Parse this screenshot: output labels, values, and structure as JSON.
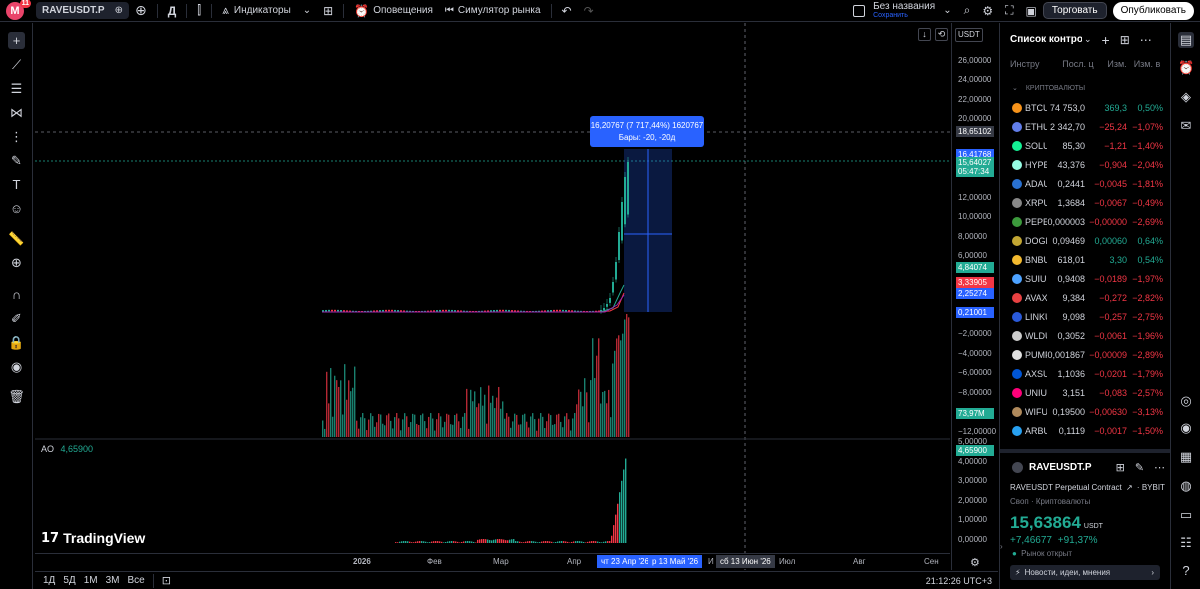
{
  "topbar": {
    "notif_count": "11",
    "symbol": "RAVEUSDT.P",
    "interval": "Д",
    "indicators": "Индикаторы",
    "alerts": "Оповещения",
    "replay": "Симулятор рынка",
    "layout_name": "Без названия",
    "layout_status": "Сохранить",
    "trade": "Торговать",
    "publish": "Опубликовать"
  },
  "chart_header": {
    "currency": "USDT"
  },
  "price_axis": {
    "labels": [
      "26,00000",
      "24,00000",
      "22,00000",
      "20,00000",
      "12,00000",
      "10,00000",
      "8,00000",
      "6,00000",
      "−2,00000",
      "−4,00000",
      "−6,00000",
      "−8,00000",
      "−12,00000"
    ],
    "crosshair": "18,65102",
    "tag_top": "16,41768",
    "tag_price": "15,64027",
    "tag_timer": "05:47:34",
    "tag_ema1": "4,84074",
    "tag_ema2": "3,33905",
    "tag_ema3": "2,25274",
    "tag_low": "0,21001",
    "tag_volume": "73,97M",
    "osc_labels": [
      "5,00000",
      "4,00000",
      "3,00000",
      "2,00000",
      "1,00000",
      "0,00000"
    ],
    "tag_osc": "4,65900"
  },
  "measure": {
    "line1": "16,20767 (7 717,44%) 1620767",
    "line2": "Бары: -20, -20д"
  },
  "oscillator": {
    "name": "AO",
    "value": "4,65900"
  },
  "time_axis": {
    "labels": [
      "2026",
      "Фев",
      "Мар",
      "Апр",
      "Июл",
      "Авг",
      "Сен"
    ],
    "range_start": "чт 23 Апр '26",
    "range_end": "р 13 Май '26",
    "partial": "И",
    "crosshair": "сб 13 Июн '26"
  },
  "bottombar": {
    "ranges": [
      "1Д",
      "5Д",
      "1М",
      "3М",
      "Все"
    ],
    "clock": "21:12:26 UTC+3"
  },
  "watermark": "TradingView",
  "watchlist": {
    "title": "Список контрол",
    "columns": [
      "Инстру",
      "Посл. ц",
      "Изм.",
      "Изм. в"
    ],
    "section": "КРИПТОВАЛЮТЫ",
    "items": [
      {
        "sym": "BTCUS",
        "last": "74 753,0",
        "chg": "369,3",
        "pct": "0,50%",
        "dir": "pos",
        "color": "#f7931a"
      },
      {
        "sym": "ETHUS",
        "last": "2 342,70",
        "chg": "−25,24",
        "pct": "−1,07%",
        "dir": "neg",
        "color": "#627eea"
      },
      {
        "sym": "SOLUS",
        "last": "85,30",
        "chg": "−1,21",
        "pct": "−1,40%",
        "dir": "neg",
        "color": "#14f195"
      },
      {
        "sym": "HYPEI",
        "last": "43,376",
        "chg": "−0,904",
        "pct": "−2,04%",
        "dir": "neg",
        "color": "#97fce4"
      },
      {
        "sym": "ADAUS",
        "last": "0,2441",
        "chg": "−0,0045",
        "pct": "−1,81%",
        "dir": "neg",
        "color": "#2a71d0"
      },
      {
        "sym": "XRPUS",
        "last": "1,3684",
        "chg": "−0,0067",
        "pct": "−0,49%",
        "dir": "neg",
        "color": "#888888"
      },
      {
        "sym": "PEPEU",
        "last": "0,000003",
        "chg": "−0,00000",
        "pct": "−2,69%",
        "dir": "neg",
        "color": "#3c9a3c"
      },
      {
        "sym": "DOGEI",
        "last": "0,09469",
        "chg": "0,00060",
        "pct": "0,64%",
        "dir": "pos",
        "color": "#c2a633"
      },
      {
        "sym": "BNBUS",
        "last": "618,01",
        "chg": "3,30",
        "pct": "0,54%",
        "dir": "pos",
        "color": "#f3ba2f"
      },
      {
        "sym": "SUIUS",
        "last": "0,9408",
        "chg": "−0,0189",
        "pct": "−1,97%",
        "dir": "neg",
        "color": "#4da2ff"
      },
      {
        "sym": "AVAXU",
        "last": "9,384",
        "chg": "−0,272",
        "pct": "−2,82%",
        "dir": "neg",
        "color": "#e84142"
      },
      {
        "sym": "LINKU",
        "last": "9,098",
        "chg": "−0,257",
        "pct": "−2,75%",
        "dir": "neg",
        "color": "#2a5ada"
      },
      {
        "sym": "WLDU",
        "last": "0,3052",
        "chg": "−0,0061",
        "pct": "−1,96%",
        "dir": "neg",
        "color": "#cccccc"
      },
      {
        "sym": "PUMP",
        "last": "0,001867",
        "chg": "−0,00009",
        "pct": "−2,89%",
        "dir": "neg",
        "color": "#e0e0e0"
      },
      {
        "sym": "AXSUS",
        "last": "1,1036",
        "chg": "−0,0201",
        "pct": "−1,79%",
        "dir": "neg",
        "color": "#0055d5"
      },
      {
        "sym": "UNIUS",
        "last": "3,151",
        "chg": "−0,083",
        "pct": "−2,57%",
        "dir": "neg",
        "color": "#ff007a"
      },
      {
        "sym": "WIFUS",
        "last": "0,19500",
        "chg": "−0,00630",
        "pct": "−3,13%",
        "dir": "neg",
        "color": "#b08a5c"
      },
      {
        "sym": "ARBUS",
        "last": "0,1119",
        "chg": "−0,0017",
        "pct": "−1,50%",
        "dir": "neg",
        "color": "#28a0f0"
      }
    ]
  },
  "details": {
    "symbol": "RAVEUSDT.P",
    "description": "RAVEUSDT Perpetual Contract",
    "exchange": "BYBIT",
    "type": "Своп",
    "category": "Криптовалюты",
    "price": "15,63864",
    "currency": "USDT",
    "change": "+7,46677",
    "change_pct": "+91,37%",
    "market_status": "Рынок открыт",
    "news": "Новости, идеи, мнения"
  },
  "colors": {
    "up": "#22ab94",
    "down": "#f23645",
    "accent": "#2962ff"
  }
}
